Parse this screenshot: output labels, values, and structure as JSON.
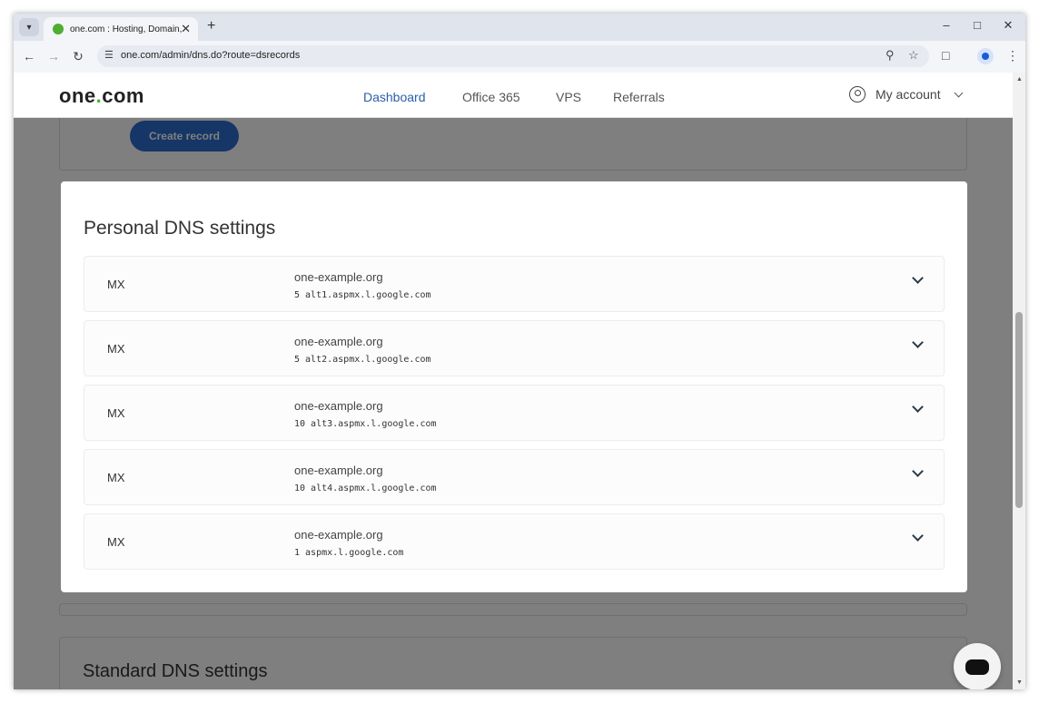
{
  "browser": {
    "tab_title": "one.com : Hosting, Domain, Em",
    "url": "one.com/admin/dns.do?route=dsrecords"
  },
  "header": {
    "logo_main": "one",
    "logo_dot": ".",
    "logo_tail": "com",
    "nav": [
      {
        "label": "Dashboard",
        "active": true
      },
      {
        "label": "Office 365",
        "active": false
      },
      {
        "label": "VPS",
        "active": false
      },
      {
        "label": "Referrals",
        "active": false
      }
    ],
    "account_label": "My account"
  },
  "background": {
    "create_record_label": "Create record",
    "standard_title": "Standard DNS settings"
  },
  "modal": {
    "title": "Personal DNS settings",
    "records": [
      {
        "type": "MX",
        "host": "one-example.org",
        "value": "5 alt1.aspmx.l.google.com"
      },
      {
        "type": "MX",
        "host": "one-example.org",
        "value": "5 alt2.aspmx.l.google.com"
      },
      {
        "type": "MX",
        "host": "one-example.org",
        "value": "10 alt3.aspmx.l.google.com"
      },
      {
        "type": "MX",
        "host": "one-example.org",
        "value": "10 alt4.aspmx.l.google.com"
      },
      {
        "type": "MX",
        "host": "one-example.org",
        "value": "1 aspmx.l.google.com"
      }
    ]
  },
  "colors": {
    "brand_green": "#4fae2f",
    "link_blue": "#2a5ea8",
    "button_blue": "#2a6dcf"
  }
}
